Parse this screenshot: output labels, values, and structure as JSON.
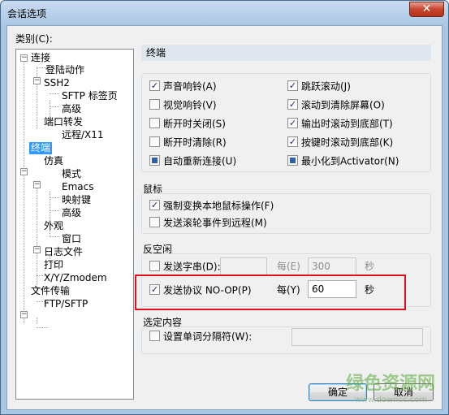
{
  "window": {
    "title": "会话选项",
    "close_glyph": "✕"
  },
  "category_label": "类别(C):",
  "tree": {
    "items": [
      {
        "label": "连接"
      },
      {
        "label": "登陆动作"
      },
      {
        "label": "SSH2"
      },
      {
        "label": "SFTP 标签页"
      },
      {
        "label": "高级"
      },
      {
        "label": "端口转发"
      },
      {
        "label": "远程/X11"
      },
      {
        "label": "终端"
      },
      {
        "label": "仿真"
      },
      {
        "label": "模式"
      },
      {
        "label": "Emacs"
      },
      {
        "label": "映射键"
      },
      {
        "label": "高级"
      },
      {
        "label": "外观"
      },
      {
        "label": "窗口"
      },
      {
        "label": "日志文件"
      },
      {
        "label": "打印"
      },
      {
        "label": "X/Y/Zmodem"
      },
      {
        "label": "文件传输"
      },
      {
        "label": "FTP/SFTP"
      }
    ],
    "expander_minus": "−"
  },
  "panel": {
    "title": "终端"
  },
  "terminal_options": {
    "left": [
      {
        "label": "声音响铃(A)",
        "checked": true
      },
      {
        "label": "视觉响铃(V)",
        "checked": false
      },
      {
        "label": "断开时关闭(S)",
        "checked": false
      },
      {
        "label": "断开时清除(R)",
        "checked": false
      },
      {
        "label": "自动重新连接(U)",
        "checked": "filled"
      }
    ],
    "right": [
      {
        "label": "跳跃滚动(J)",
        "checked": true
      },
      {
        "label": "滚动到清除屏幕(O)",
        "checked": true
      },
      {
        "label": "输出时滚动到底部(T)",
        "checked": true
      },
      {
        "label": "按键时滚动到底部(K)",
        "checked": true
      },
      {
        "label": "最小化到Activator(N)",
        "checked": "filled"
      }
    ]
  },
  "mouse": {
    "label": "鼠标",
    "options": [
      {
        "label": "强制变换本地鼠标操作(F)",
        "checked": true
      },
      {
        "label": "发送滚轮事件到远程(M)",
        "checked": false
      }
    ]
  },
  "anti_idle": {
    "label": "反空闲",
    "send_string": {
      "label": "发送字串(D):",
      "checked": false,
      "value": "",
      "every_label": "每(E)",
      "interval": "300",
      "unit": "秒"
    },
    "send_noop": {
      "label": "发送协议 NO-OP(P)",
      "checked": true,
      "every_label": "每(Y)",
      "interval": "60",
      "unit": "秒"
    }
  },
  "selection": {
    "label": "选定内容",
    "word_delim": {
      "label": "设置单词分隔符(W):",
      "checked": false,
      "value": ""
    }
  },
  "buttons": {
    "ok": "确定",
    "cancel": "取消"
  },
  "watermark": {
    "text": "绿色资源网",
    "url": "www.downcc.com"
  },
  "check_glyph": "✓"
}
